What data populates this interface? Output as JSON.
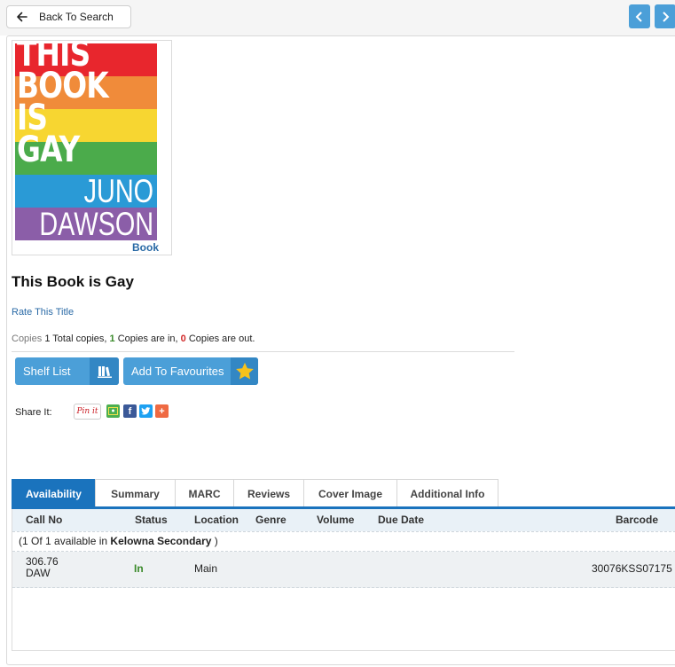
{
  "topbar": {
    "back_label": "Back To Search",
    "back_icon": "arrow-left-icon",
    "prev_icon": "chevron-left-icon",
    "next_icon": "chevron-right-icon"
  },
  "cover": {
    "text": {
      "line1": "THIS",
      "line2": "BOOK",
      "line3": "IS",
      "line4": "GAY",
      "author1": "JUNO",
      "author2": "DAWSON"
    },
    "type_label": "Book",
    "stripe_colors": [
      "#e8262d",
      "#f08b3a",
      "#f7d631",
      "#4bab4b",
      "#2a9ad6",
      "#8b5ea8"
    ]
  },
  "title": "This Book is Gay",
  "rate_label": "Rate This Title",
  "copies": {
    "label": "Copies",
    "total": "1",
    "total_text": "Total copies,",
    "in": "1",
    "in_text": "Copies are in,",
    "out": "0",
    "out_text": "Copies are out."
  },
  "actions": {
    "shelf_label": "Shelf List",
    "shelf_icon": "books-icon",
    "fav_label": "Add To Favourites",
    "fav_icon": "star-icon"
  },
  "share": {
    "label": "Share It:",
    "pinit": "Pin it",
    "icons": [
      "google-classroom-icon",
      "facebook-icon",
      "twitter-icon",
      "plus-share-icon"
    ]
  },
  "tabs": [
    {
      "label": "Availability",
      "active": true
    },
    {
      "label": "Summary"
    },
    {
      "label": "MARC"
    },
    {
      "label": "Reviews"
    },
    {
      "label": "Cover Image"
    },
    {
      "label": "Additional Info"
    }
  ],
  "table": {
    "headers": {
      "call_no": "Call No",
      "status": "Status",
      "location": "Location",
      "genre": "Genre",
      "volume": "Volume",
      "due_date": "Due Date",
      "barcode": "Barcode"
    },
    "group": {
      "prefix": "(1 Of 1 available in",
      "library": "Kelowna Secondary",
      "suffix": ")"
    },
    "row": {
      "call_no_1": "306.76",
      "call_no_2": "DAW",
      "status": "In",
      "location": "Main",
      "barcode": "30076KSS07175"
    }
  },
  "colors": {
    "accent": "#4b9fd8",
    "tab_active": "#1a73bd",
    "status_in": "#3a8a2a",
    "count_out": "#d12a2a"
  }
}
